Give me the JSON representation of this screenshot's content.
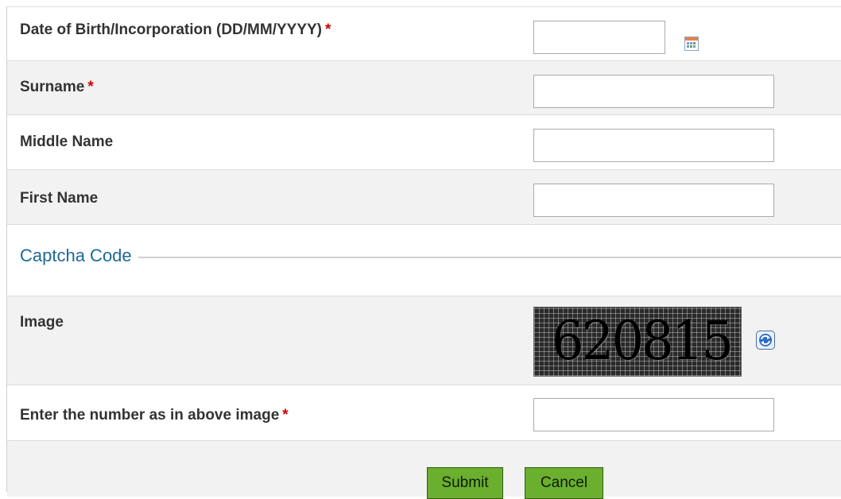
{
  "form": {
    "dob": {
      "label": "Date of Birth/Incorporation (DD/MM/YYYY)",
      "required_marker": "*",
      "value": ""
    },
    "surname": {
      "label": "Surname",
      "required_marker": "*",
      "value": ""
    },
    "middle_name": {
      "label": "Middle Name",
      "value": ""
    },
    "first_name": {
      "label": "First Name",
      "value": ""
    },
    "captcha_section": {
      "legend": "Captcha Code"
    },
    "captcha_image": {
      "label": "Image",
      "code": "620815"
    },
    "captcha_answer": {
      "label": "Enter the number as in above image",
      "required_marker": "*",
      "value": ""
    },
    "buttons": {
      "submit": "Submit",
      "cancel": "Cancel"
    }
  },
  "icons": {
    "calendar": "calendar-icon",
    "refresh": "refresh-icon"
  },
  "colors": {
    "required": "#cc0000",
    "legend": "#1d6a96",
    "button": "#6aaf2e",
    "row_alt": "#f2f2f2"
  }
}
